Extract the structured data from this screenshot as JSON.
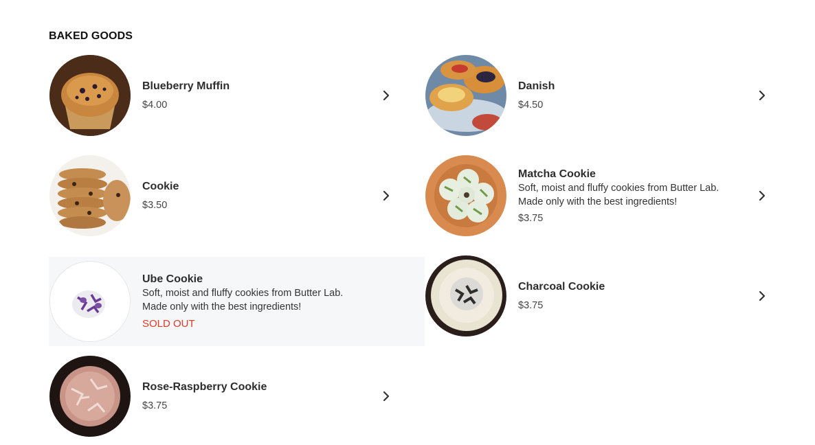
{
  "section": {
    "title": "BAKED GOODS"
  },
  "items": [
    {
      "name": "Blueberry Muffin",
      "price": "$4.00",
      "desc": "",
      "sold_out": false,
      "image_icon": "muffin-icon",
      "color": "#8a5a2b"
    },
    {
      "name": "Danish",
      "price": "$4.50",
      "desc": "",
      "sold_out": false,
      "image_icon": "danish-icon",
      "color": "#e0a34d"
    },
    {
      "name": "Cookie",
      "price": "$3.50",
      "desc": "",
      "sold_out": false,
      "image_icon": "cookie-icon",
      "color": "#c08a4a"
    },
    {
      "name": "Matcha Cookie",
      "price": "$3.75",
      "desc": "Soft, moist and fluffy cookies from Butter Lab. Made only with the best ingredients!",
      "sold_out": false,
      "image_icon": "matcha-cookie-icon",
      "color": "#7ea55a"
    },
    {
      "name": "Ube Cookie",
      "price": "",
      "desc": "Soft, moist and fluffy cookies from Butter Lab. Made only with the best ingredients!",
      "sold_out": true,
      "sold_out_label": "SOLD OUT",
      "image_icon": "ube-cookie-icon",
      "color": "#7b4ea3"
    },
    {
      "name": "Charcoal Cookie",
      "price": "$3.75",
      "desc": "",
      "sold_out": false,
      "image_icon": "charcoal-cookie-icon",
      "color": "#3a3a3a"
    },
    {
      "name": "Rose-Raspberry Cookie",
      "price": "$3.75",
      "desc": "",
      "sold_out": false,
      "image_icon": "rose-raspberry-cookie-icon",
      "color": "#c48a86"
    }
  ],
  "colors": {
    "sold_out": "#d93a2b",
    "soldout_bg": "#f6f7f9"
  }
}
